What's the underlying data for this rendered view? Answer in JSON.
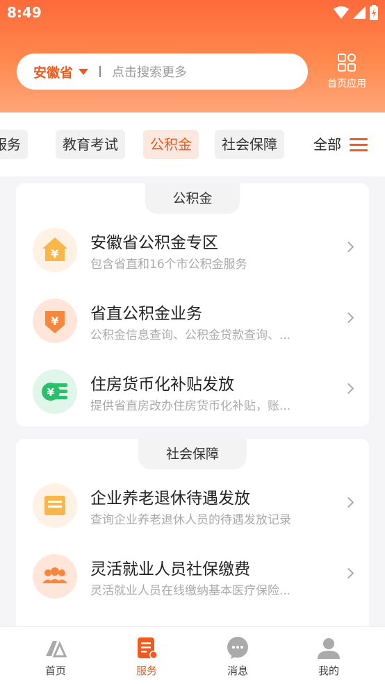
{
  "status": {
    "time": "8:49"
  },
  "search": {
    "province": "安徽省",
    "placeholder": "点击搜索更多"
  },
  "header": {
    "home_apps_label": "首页应用"
  },
  "tabs": [
    {
      "label": "服务"
    },
    {
      "label": "教育考试"
    },
    {
      "label": "公积金"
    },
    {
      "label": "社会保障"
    }
  ],
  "tab_all_label": "全部",
  "sections": [
    {
      "title": "公积金",
      "items": [
        {
          "title": "安徽省公积金专区",
          "desc": "包含省直和16个市公积金服务",
          "icon": "house-yen-icon"
        },
        {
          "title": "省直公积金业务",
          "desc": "公积金信息查询、公积金贷款查询、...",
          "icon": "yen-download-icon"
        },
        {
          "title": "住房货币化补贴发放",
          "desc": "提供省直房改办住房货币化补贴，账...",
          "icon": "yen-coins-icon"
        }
      ]
    },
    {
      "title": "社会保障",
      "items": [
        {
          "title": "企业养老退休待遇发放",
          "desc": "查询企业养老退休人员的待遇发放记录",
          "icon": "document-icon"
        },
        {
          "title": "灵活就业人员社保缴费",
          "desc": "灵活就业人员在线缴纳基本医疗保险...",
          "icon": "people-icon"
        }
      ]
    }
  ],
  "bottom_nav": [
    {
      "label": "首页"
    },
    {
      "label": "服务"
    },
    {
      "label": "消息"
    },
    {
      "label": "我的"
    }
  ],
  "colors": {
    "accent": "#ef5a1e",
    "header_top": "#ff6a3a",
    "header_bottom": "#ffa57a"
  }
}
